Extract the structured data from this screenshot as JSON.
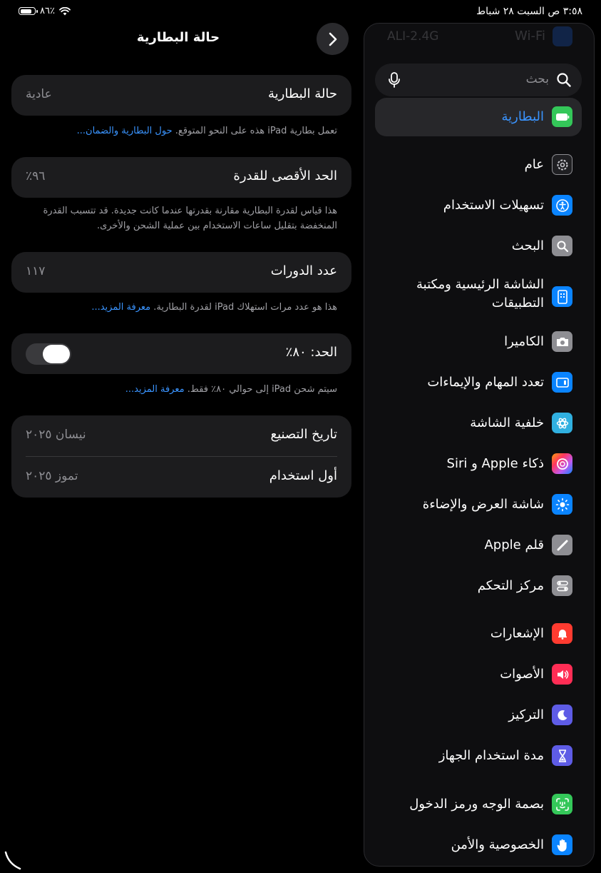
{
  "status_bar": {
    "time_date": "٣:٥٨ ص   السبت ٢٨ شباط",
    "battery_percent": "٨٦٪",
    "battery_level": 0.86
  },
  "sidebar": {
    "wifi_label": "Wi-Fi",
    "wifi_network": "ALI-2.4G",
    "search_placeholder": "بحث",
    "selected": {
      "label": "البطارية",
      "icon": "battery-icon",
      "color": "#34c759"
    },
    "items": [
      {
        "label": "عام",
        "icon": "gear-icon",
        "color": "#8e8e93"
      },
      {
        "label": "تسهيلات الاستخدام",
        "icon": "accessibility-icon",
        "color": "#0a84ff"
      },
      {
        "label": "البحث",
        "icon": "search-icon",
        "color": "#8e8e93"
      },
      {
        "label": "الشاشة الرئيسية ومكتبة التطبيقات",
        "icon": "home-screen-icon",
        "color": "#0a84ff"
      },
      {
        "label": "الكاميرا",
        "icon": "camera-icon",
        "color": "#8e8e93"
      },
      {
        "label": "تعدد المهام والإيماءات",
        "icon": "multitasking-icon",
        "color": "#0a84ff"
      },
      {
        "label": "خلفية الشاشة",
        "icon": "wallpaper-icon",
        "color": "#30b0e0"
      },
      {
        "label": "ذكاء Apple و Siri",
        "icon": "siri-icon",
        "color": "#d36cf0"
      },
      {
        "label": "شاشة العرض والإضاءة",
        "icon": "brightness-icon",
        "color": "#0a84ff"
      },
      {
        "label": "قلم Apple",
        "icon": "pencil-icon",
        "color": "#8e8e93"
      },
      {
        "label": "مركز التحكم",
        "icon": "control-center-icon",
        "color": "#8e8e93"
      },
      {
        "label": "الإشعارات",
        "icon": "notifications-icon",
        "color": "#ff3b30"
      },
      {
        "label": "الأصوات",
        "icon": "sounds-icon",
        "color": "#ff2d55"
      },
      {
        "label": "التركيز",
        "icon": "focus-icon",
        "color": "#5e5ce6"
      },
      {
        "label": "مدة استخدام الجهاز",
        "icon": "screen-time-icon",
        "color": "#5e5ce6"
      },
      {
        "label": "بصمة الوجه ورمز الدخول",
        "icon": "face-id-icon",
        "color": "#34c759"
      },
      {
        "label": "الخصوصية والأمن",
        "icon": "hand-icon",
        "color": "#0a84ff"
      }
    ]
  },
  "detail": {
    "title": "حالة البطارية",
    "battery_health": {
      "label": "حالة البطارية",
      "value": "عادية"
    },
    "battery_health_note": "تعمل بطارية iPad هذه على النحو المتوقع.",
    "battery_health_link": "حول البطارية والضمان...",
    "max_capacity": {
      "label": "الحد الأقصى للقدرة",
      "value": "٩٦٪"
    },
    "max_capacity_note": "هذا قياس لقدرة البطارية مقارنة بقدرتها عندما كانت جديدة. قد تتسبب القدرة المنخفضة بتقليل ساعات الاستخدام بين عملية الشحن والأخرى.",
    "cycle_count": {
      "label": "عدد الدورات",
      "value": "١١٧"
    },
    "cycle_count_note": "هذا هو عدد مرات استهلاك iPad لقدرة البطارية.",
    "cycle_count_link": "معرفة المزيد...",
    "limit": {
      "label": "الحد: ٨٠٪",
      "enabled": true
    },
    "limit_note": "سيتم شحن iPad إلى حوالي ٨٠٪ فقط.",
    "limit_link": "معرفة المزيد...",
    "manufacture_date": {
      "label": "تاريخ التصنيع",
      "value": "نيسان ٢٠٢٥"
    },
    "first_use": {
      "label": "أول استخدام",
      "value": "تموز ٢٠٢٥"
    }
  }
}
